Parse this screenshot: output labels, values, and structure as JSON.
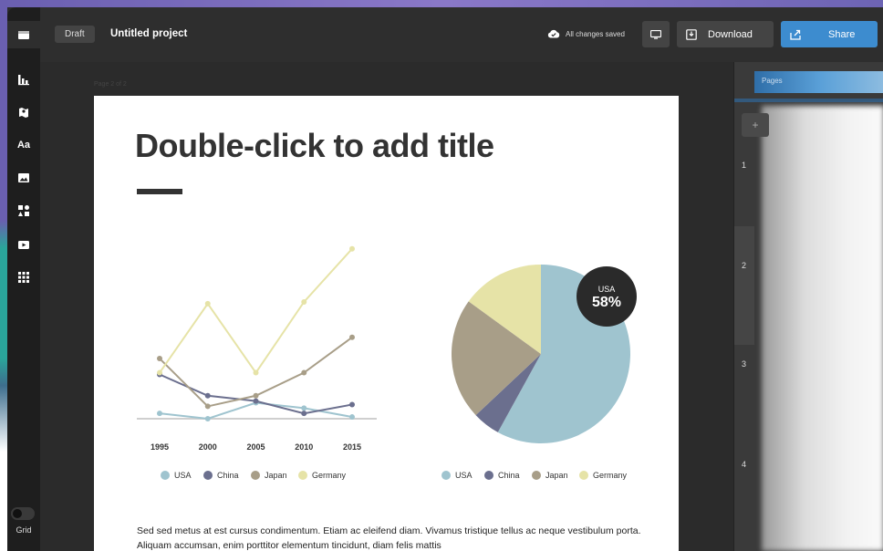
{
  "header": {
    "draft_label": "Draft",
    "project_title": "Untitled project",
    "save_status": "All changes saved",
    "download_label": "Download",
    "share_label": "Share"
  },
  "toolbar": {
    "items": [
      "layout-icon",
      "chart-icon",
      "map-icon",
      "text",
      "image-icon",
      "shapes-icon",
      "video-icon",
      "apps-icon"
    ],
    "text_item_label": "Aa",
    "grid_label": "Grid",
    "grid_enabled": false
  },
  "canvas": {
    "page_label": "Page 2 of 2",
    "title": "Double-click to add title",
    "body_text": "Sed sed metus at est cursus condimentum. Etiam ac eleifend diam. Vivamus tristique tellus ac neque vestibulum porta. Aliquam accumsan, enim porttitor elementum tincidunt, diam felis mattis"
  },
  "chart_data": [
    {
      "type": "line",
      "x": [
        "1995",
        "2000",
        "2005",
        "2010",
        "2015"
      ],
      "series": [
        {
          "name": "USA",
          "color": "#9fc4cf",
          "values": [
            3,
            0,
            9,
            6,
            1
          ]
        },
        {
          "name": "China",
          "color": "#6b6f8e",
          "values": [
            25,
            13,
            10,
            3,
            8
          ]
        },
        {
          "name": "Japan",
          "color": "#a89e88",
          "values": [
            34,
            7,
            13,
            26,
            46
          ]
        },
        {
          "name": "Germany",
          "color": "#e6e3a7",
          "values": [
            26,
            65,
            26,
            66,
            96
          ]
        }
      ],
      "ylim": [
        0,
        100
      ],
      "legend_position": "bottom"
    },
    {
      "type": "pie",
      "labels": [
        "USA",
        "China",
        "Japan",
        "Germany"
      ],
      "values": [
        58,
        5,
        22,
        15
      ],
      "colors": [
        "#9fc4cf",
        "#6b6f8e",
        "#a89e88",
        "#e6e3a7"
      ],
      "callout": {
        "label": "USA",
        "value": "58%"
      },
      "legend_position": "bottom"
    }
  ],
  "panel": {
    "tab_label": "Pages",
    "add_label": "+",
    "row_numbers": [
      "1",
      "2",
      "3",
      "4"
    ]
  }
}
